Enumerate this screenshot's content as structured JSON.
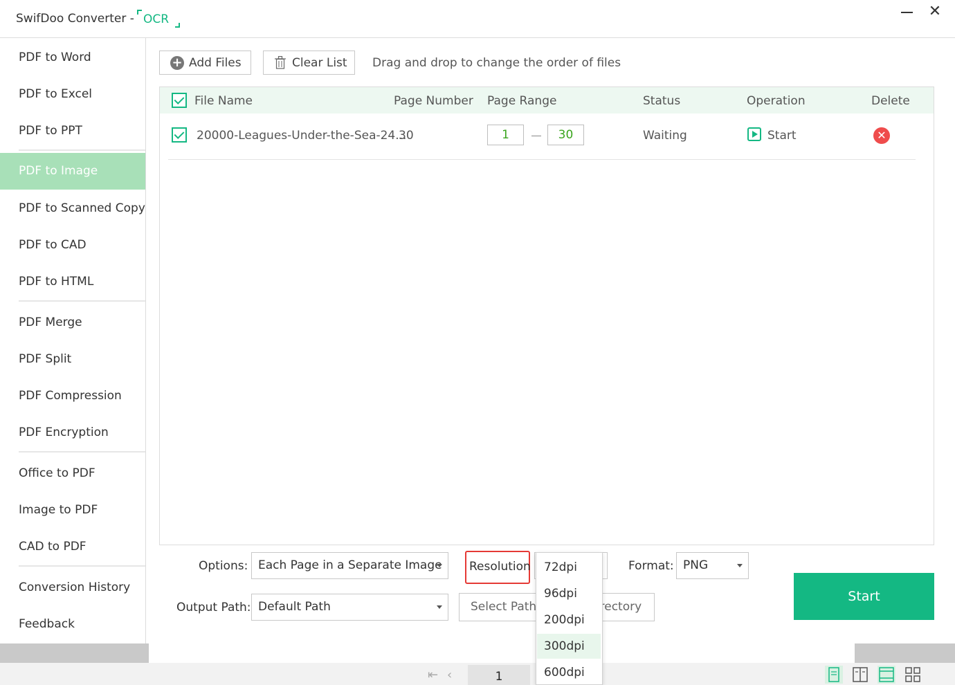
{
  "titlebar": {
    "app_title": "SwifDoo Converter -",
    "ocr_badge": "OCR",
    "minimize_label": "",
    "close_label": "✕"
  },
  "sidebar": {
    "items": [
      {
        "label": "PDF to Word"
      },
      {
        "label": "PDF to Excel"
      },
      {
        "label": "PDF to PPT"
      },
      {
        "label": "PDF to Image",
        "active": true
      },
      {
        "label": "PDF to Scanned Copy"
      },
      {
        "label": "PDF to CAD"
      },
      {
        "label": "PDF to HTML"
      },
      {
        "label": "PDF Merge"
      },
      {
        "label": "PDF Split"
      },
      {
        "label": "PDF Compression"
      },
      {
        "label": "PDF Encryption"
      },
      {
        "label": "Office to PDF"
      },
      {
        "label": "Image to PDF"
      },
      {
        "label": "CAD to PDF"
      },
      {
        "label": "Conversion History"
      },
      {
        "label": "Feedback"
      }
    ]
  },
  "toolbar": {
    "add_files": "Add Files",
    "clear_list": "Clear List",
    "drag_hint": "Drag and drop to change the order of files"
  },
  "table": {
    "headers": {
      "file_name": "File Name",
      "page_number": "Page Number",
      "page_range": "Page Range",
      "status": "Status",
      "operation": "Operation",
      "delete": "Delete"
    },
    "rows": [
      {
        "checked": true,
        "file_name": "20000-Leagues-Under-the-Sea-24...",
        "page_number": "30",
        "range_from": "1",
        "range_to": "30",
        "status": "Waiting",
        "operation": "Start"
      }
    ]
  },
  "options": {
    "options_label": "Options:",
    "options_value": "Each Page in a Separate Image",
    "resolution_label": "Resolution",
    "format_label": "Format:",
    "format_value": "PNG",
    "output_path_label": "Output Path:",
    "output_path_value": "Default Path",
    "select_path": "Select Path",
    "open_directory": "Open Directory",
    "start": "Start"
  },
  "resolution_dropdown": {
    "options": [
      "72dpi",
      "96dpi",
      "200dpi",
      "300dpi",
      "600dpi"
    ],
    "highlighted": "300dpi"
  },
  "statusbar": {
    "current_page": "1"
  },
  "colors": {
    "accent": "#14b883",
    "active_sidebar": "#a8e0b8",
    "header_bg": "#edf8f1",
    "delete_red": "#ef4c4c",
    "highlight_red": "#e53935"
  }
}
